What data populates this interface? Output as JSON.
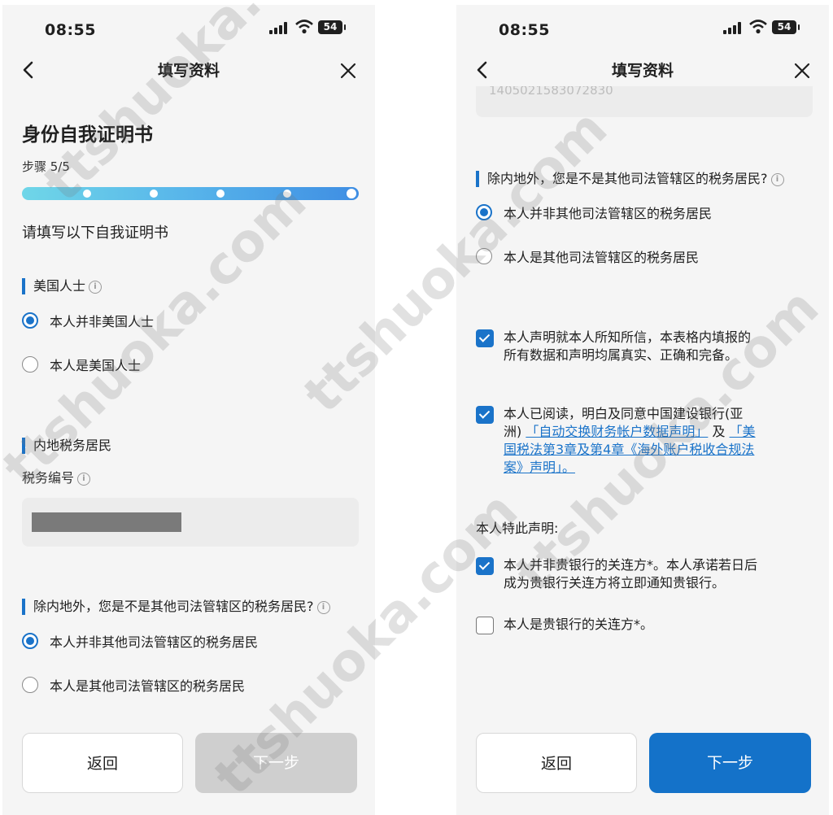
{
  "status_bar": {
    "time": "08:55",
    "battery": "54"
  },
  "nav": {
    "title": "填写资料"
  },
  "left": {
    "heading": "身份自我证明书",
    "step": "步骤 5/5",
    "progress": {
      "current": 5,
      "total": 5
    },
    "intro": "请填写以下自我证明书",
    "us_person": {
      "label": "美国人士",
      "options": [
        "本人并非美国人士",
        "本人是美国人士"
      ],
      "selected": 0
    },
    "mainland": {
      "label": "内地税务居民",
      "field_label": "税务编号"
    },
    "other_juris": {
      "label": "除内地外，您是不是其他司法管辖区的税务居民?",
      "options": [
        "本人并非其他司法管辖区的税务居民",
        "本人是其他司法管辖区的税务居民"
      ],
      "selected": 0
    },
    "buttons": {
      "back": "返回",
      "next": "下一步"
    }
  },
  "right": {
    "cut_input_value": "1405021583072830",
    "other_juris": {
      "label": "除内地外，您是不是其他司法管辖区的税务居民?",
      "options": [
        "本人并非其他司法管辖区的税务居民",
        "本人是其他司法管辖区的税务居民"
      ],
      "selected": 0
    },
    "declare_true": {
      "line1": "本人声明就本人所知所信，本表格内填报的",
      "line2": "所有数据和声明均属真实、正确和完备。",
      "checked": true
    },
    "agree": {
      "line1": "本人已阅读，明白及同意中国建设银行(亚",
      "line2_pre": "洲) ",
      "link1": "「自动交换财务帐户数据声明」",
      "line2_mid": " 及 ",
      "link2_part1": "「美",
      "link2_part2": "国税法第3章及第4章《海外账户税收合规法",
      "link2_part3": "案》声明」。",
      "checked": true
    },
    "hereby": "本人特此声明:",
    "not_related": {
      "line1": "本人并非贵银行的关连方*。本人承诺若日后",
      "line2": "成为贵银行关连方将立即通知贵银行。",
      "checked": true
    },
    "is_related": {
      "text": "本人是贵银行的关连方*。",
      "checked": false
    },
    "buttons": {
      "back": "返回",
      "next": "下一步"
    }
  },
  "watermark": "ttshuoka.com",
  "colors": {
    "accent": "#1a73c9",
    "button_primary": "#1472c9",
    "disabled": "#cfcfcf"
  }
}
